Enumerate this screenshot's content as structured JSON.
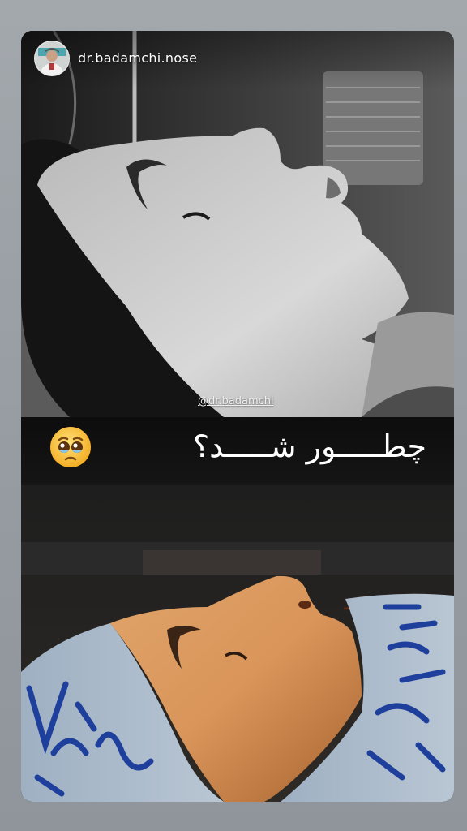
{
  "story": {
    "username": "dr.badamchi.nose",
    "watermark": "@dr.badamchi",
    "caption": "چطـــــور شـــــد؟",
    "caption_emoji_icon": "pleading-face-emoji-icon"
  },
  "colors": {
    "page_background": "#9aa0a6",
    "caption_text": "#ffffff",
    "surgical_cap": "#a9b7c5",
    "cap_lettering": "#1f3f9c",
    "skin_tone": "#d9955a"
  }
}
